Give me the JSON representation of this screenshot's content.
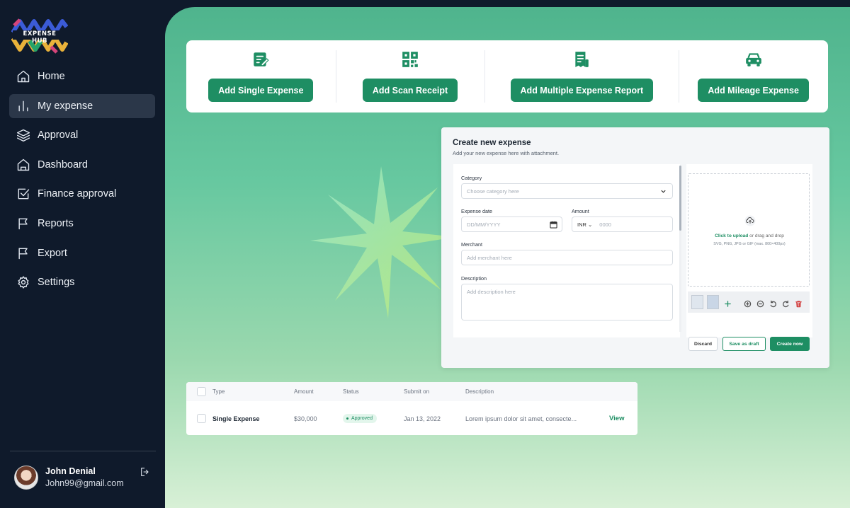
{
  "app": {
    "logo_text": "EXPENSE HUB"
  },
  "sidebar": {
    "items": [
      {
        "label": "Home",
        "icon": "home-icon"
      },
      {
        "label": "My expense",
        "icon": "bar-chart-icon",
        "active": true
      },
      {
        "label": "Approval",
        "icon": "layers-icon"
      },
      {
        "label": "Dashboard",
        "icon": "dashboard-icon"
      },
      {
        "label": "Finance approval",
        "icon": "check-square-icon"
      },
      {
        "label": "Reports",
        "icon": "flag-icon"
      },
      {
        "label": "Export",
        "icon": "flag-icon"
      },
      {
        "label": "Settings",
        "icon": "gear-icon"
      }
    ],
    "user": {
      "name": "John Denial",
      "email": "John99@gmail.com"
    }
  },
  "actions": [
    {
      "label": "Add Single Expense",
      "icon": "edit-document-icon"
    },
    {
      "label": "Add Scan Receipt",
      "icon": "qr-code-icon"
    },
    {
      "label": "Add Multiple Expense Report",
      "icon": "receipt-icon"
    },
    {
      "label": "Add Mileage Expense",
      "icon": "car-icon"
    }
  ],
  "create_form": {
    "title": "Create new expense",
    "subtitle": "Add your new expense here with attachment.",
    "category_label": "Category",
    "category_placeholder": "Choose category here",
    "date_label": "Expense date",
    "date_placeholder": "DD/MM/YYYY",
    "amount_label": "Amount",
    "currency": "INR",
    "amount_placeholder": "0000",
    "merchant_label": "Merchant",
    "merchant_placeholder": "Add merchant here",
    "description_label": "Description",
    "description_placeholder": "Add description here",
    "upload_link": "Click to upload",
    "upload_text": " or drag and drop",
    "upload_hint": "SVG, PNG, JPG or GIF (max. 800×400px)",
    "discard_label": "Discard",
    "draft_label": "Save as draft",
    "create_label": "Create now"
  },
  "table": {
    "headers": [
      "Type",
      "Amount",
      "Status",
      "Submit on",
      "Description"
    ],
    "rows": [
      {
        "type": "Single Expense",
        "amount": "$30,000",
        "status": "Approved",
        "submit_on": "Jan 13, 2022",
        "description": "Lorem ipsum dolor sit amet, consecte...",
        "action": "View"
      }
    ]
  },
  "colors": {
    "primary": "#1e8e63",
    "sidebar_bg": "#0f1a2b",
    "active_item": "#2b3749"
  }
}
